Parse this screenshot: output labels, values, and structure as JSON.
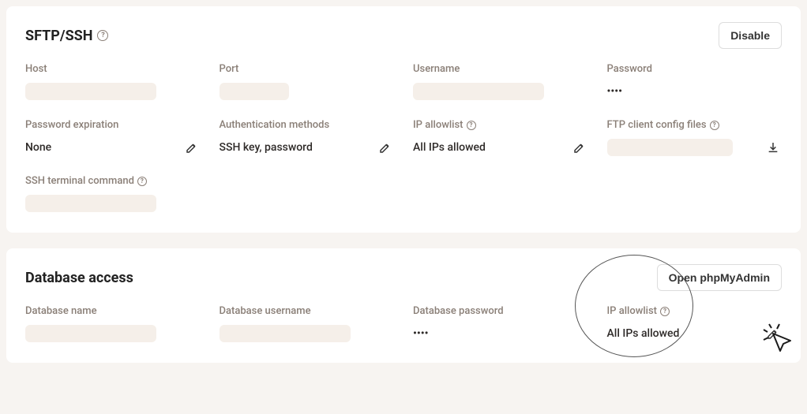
{
  "sftp": {
    "title": "SFTP/SSH",
    "disable_button": "Disable",
    "fields": {
      "host": {
        "label": "Host"
      },
      "port": {
        "label": "Port"
      },
      "username": {
        "label": "Username"
      },
      "password": {
        "label": "Password",
        "value": "••••"
      },
      "password_expiration": {
        "label": "Password expiration",
        "value": "None"
      },
      "auth_methods": {
        "label": "Authentication methods",
        "value": "SSH key, password"
      },
      "ip_allowlist": {
        "label": "IP allowlist",
        "value": "All IPs allowed"
      },
      "ftp_client_config": {
        "label": "FTP client config files"
      },
      "ssh_terminal": {
        "label": "SSH terminal command"
      }
    }
  },
  "db": {
    "title": "Database access",
    "open_button": "Open phpMyAdmin",
    "fields": {
      "db_name": {
        "label": "Database name"
      },
      "db_username": {
        "label": "Database username"
      },
      "db_password": {
        "label": "Database password",
        "value": "••••"
      },
      "ip_allowlist": {
        "label": "IP allowlist",
        "value": "All IPs allowed"
      }
    }
  }
}
